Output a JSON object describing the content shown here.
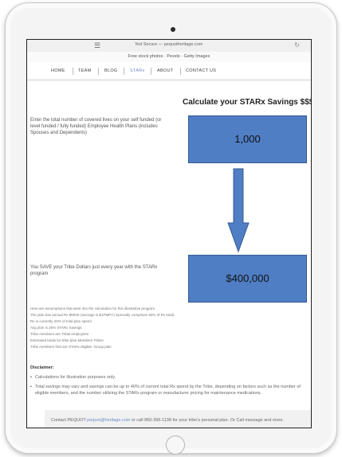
{
  "browser": {
    "url": "Not Secure — pequotheritage.com",
    "attribution": "Free stock photos · Pexels · Getty Images"
  },
  "nav": {
    "items": [
      {
        "label": "HOME"
      },
      {
        "label": "TEAM"
      },
      {
        "label": "BLOG"
      },
      {
        "label": "STARx"
      },
      {
        "label": "ABOUT"
      },
      {
        "label": "CONTACT US"
      }
    ],
    "active": "STARx"
  },
  "main": {
    "title": "Calculate your STARx Savings $$$",
    "enrolled_prompt": "Enter the total number of covered lives on your self funded (or level funded / fully funded) Employee Health Plans (includes Spouses and Dependents)",
    "enrolled_value": "1,000",
    "savings_text": "You SAVE your Tribe Dollars just every year with the STARx program",
    "savings_value": "$400,000"
  },
  "fine_print": [
    "Here are assumptions that went into the calculation for this illustrative program",
    "The plan has annual Rx $600K (average is $1PMPY) Specialty comprises 50% of Rx total).",
    "Rx is currently 20% of total plan spend",
    "Avg plan is 20% STARx Savings",
    "Tribe members are Tribal employees",
    "Estimated totals for tribe plan Members Tribes",
    "Tribe members that are STARx eligible. Group plan"
  ],
  "disclaimer": {
    "title": "Disclaimer:",
    "items": [
      "Calculations for illustration purposes only.",
      "Total savings may vary and savings can be up to 40% of current total Rx spend by the Tribe, depending on factors such as the number of eligible members, and the number utilizing the STARx program or manufacturer pricing for maintenance medications."
    ]
  },
  "contact": {
    "prefix": "Contact PEQUOT",
    "email": "pequot@heritage.com",
    "suffix": "or call 860-396-1138 for your tribe's personal plan. Or Call message and more."
  },
  "colors": {
    "box_fill": "#4f7ec4",
    "active_nav": "#6b8ac7"
  },
  "icons": {
    "tabs": "hamburger-icon",
    "reload": "reload-icon",
    "down_arrow": "arrow-down-icon"
  }
}
